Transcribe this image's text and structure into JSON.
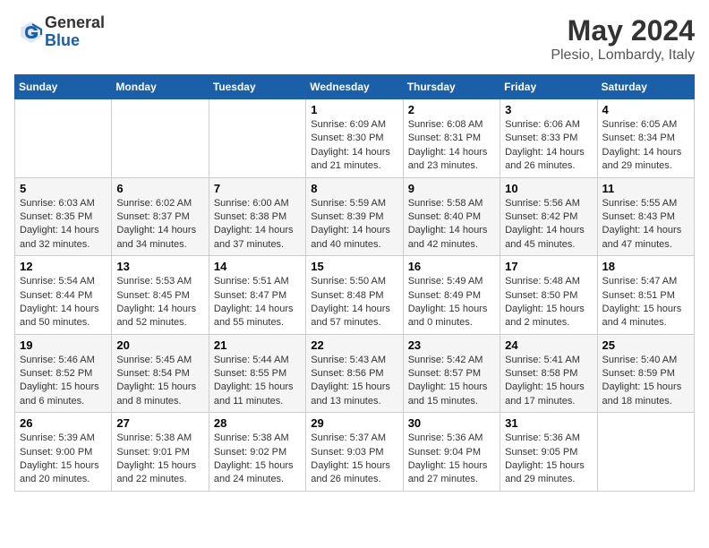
{
  "header": {
    "logo": {
      "general": "General",
      "blue": "Blue"
    },
    "title": "May 2024",
    "location": "Plesio, Lombardy, Italy"
  },
  "weekdays": [
    "Sunday",
    "Monday",
    "Tuesday",
    "Wednesday",
    "Thursday",
    "Friday",
    "Saturday"
  ],
  "weeks": [
    [
      null,
      null,
      null,
      {
        "day": "1",
        "sunrise": "Sunrise: 6:09 AM",
        "sunset": "Sunset: 8:30 PM",
        "daylight": "Daylight: 14 hours and 21 minutes."
      },
      {
        "day": "2",
        "sunrise": "Sunrise: 6:08 AM",
        "sunset": "Sunset: 8:31 PM",
        "daylight": "Daylight: 14 hours and 23 minutes."
      },
      {
        "day": "3",
        "sunrise": "Sunrise: 6:06 AM",
        "sunset": "Sunset: 8:33 PM",
        "daylight": "Daylight: 14 hours and 26 minutes."
      },
      {
        "day": "4",
        "sunrise": "Sunrise: 6:05 AM",
        "sunset": "Sunset: 8:34 PM",
        "daylight": "Daylight: 14 hours and 29 minutes."
      }
    ],
    [
      {
        "day": "5",
        "sunrise": "Sunrise: 6:03 AM",
        "sunset": "Sunset: 8:35 PM",
        "daylight": "Daylight: 14 hours and 32 minutes."
      },
      {
        "day": "6",
        "sunrise": "Sunrise: 6:02 AM",
        "sunset": "Sunset: 8:37 PM",
        "daylight": "Daylight: 14 hours and 34 minutes."
      },
      {
        "day": "7",
        "sunrise": "Sunrise: 6:00 AM",
        "sunset": "Sunset: 8:38 PM",
        "daylight": "Daylight: 14 hours and 37 minutes."
      },
      {
        "day": "8",
        "sunrise": "Sunrise: 5:59 AM",
        "sunset": "Sunset: 8:39 PM",
        "daylight": "Daylight: 14 hours and 40 minutes."
      },
      {
        "day": "9",
        "sunrise": "Sunrise: 5:58 AM",
        "sunset": "Sunset: 8:40 PM",
        "daylight": "Daylight: 14 hours and 42 minutes."
      },
      {
        "day": "10",
        "sunrise": "Sunrise: 5:56 AM",
        "sunset": "Sunset: 8:42 PM",
        "daylight": "Daylight: 14 hours and 45 minutes."
      },
      {
        "day": "11",
        "sunrise": "Sunrise: 5:55 AM",
        "sunset": "Sunset: 8:43 PM",
        "daylight": "Daylight: 14 hours and 47 minutes."
      }
    ],
    [
      {
        "day": "12",
        "sunrise": "Sunrise: 5:54 AM",
        "sunset": "Sunset: 8:44 PM",
        "daylight": "Daylight: 14 hours and 50 minutes."
      },
      {
        "day": "13",
        "sunrise": "Sunrise: 5:53 AM",
        "sunset": "Sunset: 8:45 PM",
        "daylight": "Daylight: 14 hours and 52 minutes."
      },
      {
        "day": "14",
        "sunrise": "Sunrise: 5:51 AM",
        "sunset": "Sunset: 8:47 PM",
        "daylight": "Daylight: 14 hours and 55 minutes."
      },
      {
        "day": "15",
        "sunrise": "Sunrise: 5:50 AM",
        "sunset": "Sunset: 8:48 PM",
        "daylight": "Daylight: 14 hours and 57 minutes."
      },
      {
        "day": "16",
        "sunrise": "Sunrise: 5:49 AM",
        "sunset": "Sunset: 8:49 PM",
        "daylight": "Daylight: 15 hours and 0 minutes."
      },
      {
        "day": "17",
        "sunrise": "Sunrise: 5:48 AM",
        "sunset": "Sunset: 8:50 PM",
        "daylight": "Daylight: 15 hours and 2 minutes."
      },
      {
        "day": "18",
        "sunrise": "Sunrise: 5:47 AM",
        "sunset": "Sunset: 8:51 PM",
        "daylight": "Daylight: 15 hours and 4 minutes."
      }
    ],
    [
      {
        "day": "19",
        "sunrise": "Sunrise: 5:46 AM",
        "sunset": "Sunset: 8:52 PM",
        "daylight": "Daylight: 15 hours and 6 minutes."
      },
      {
        "day": "20",
        "sunrise": "Sunrise: 5:45 AM",
        "sunset": "Sunset: 8:54 PM",
        "daylight": "Daylight: 15 hours and 8 minutes."
      },
      {
        "day": "21",
        "sunrise": "Sunrise: 5:44 AM",
        "sunset": "Sunset: 8:55 PM",
        "daylight": "Daylight: 15 hours and 11 minutes."
      },
      {
        "day": "22",
        "sunrise": "Sunrise: 5:43 AM",
        "sunset": "Sunset: 8:56 PM",
        "daylight": "Daylight: 15 hours and 13 minutes."
      },
      {
        "day": "23",
        "sunrise": "Sunrise: 5:42 AM",
        "sunset": "Sunset: 8:57 PM",
        "daylight": "Daylight: 15 hours and 15 minutes."
      },
      {
        "day": "24",
        "sunrise": "Sunrise: 5:41 AM",
        "sunset": "Sunset: 8:58 PM",
        "daylight": "Daylight: 15 hours and 17 minutes."
      },
      {
        "day": "25",
        "sunrise": "Sunrise: 5:40 AM",
        "sunset": "Sunset: 8:59 PM",
        "daylight": "Daylight: 15 hours and 18 minutes."
      }
    ],
    [
      {
        "day": "26",
        "sunrise": "Sunrise: 5:39 AM",
        "sunset": "Sunset: 9:00 PM",
        "daylight": "Daylight: 15 hours and 20 minutes."
      },
      {
        "day": "27",
        "sunrise": "Sunrise: 5:38 AM",
        "sunset": "Sunset: 9:01 PM",
        "daylight": "Daylight: 15 hours and 22 minutes."
      },
      {
        "day": "28",
        "sunrise": "Sunrise: 5:38 AM",
        "sunset": "Sunset: 9:02 PM",
        "daylight": "Daylight: 15 hours and 24 minutes."
      },
      {
        "day": "29",
        "sunrise": "Sunrise: 5:37 AM",
        "sunset": "Sunset: 9:03 PM",
        "daylight": "Daylight: 15 hours and 26 minutes."
      },
      {
        "day": "30",
        "sunrise": "Sunrise: 5:36 AM",
        "sunset": "Sunset: 9:04 PM",
        "daylight": "Daylight: 15 hours and 27 minutes."
      },
      {
        "day": "31",
        "sunrise": "Sunrise: 5:36 AM",
        "sunset": "Sunset: 9:05 PM",
        "daylight": "Daylight: 15 hours and 29 minutes."
      },
      null
    ]
  ]
}
